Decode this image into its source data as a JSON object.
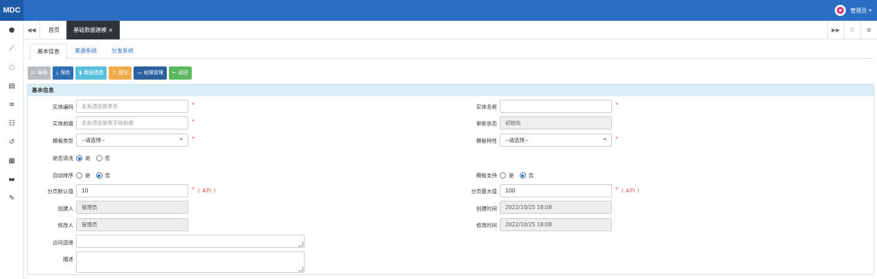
{
  "app": {
    "brand": "MDC"
  },
  "user": {
    "name": "管理员",
    "caret": "▾"
  },
  "sidebar": {
    "icons": [
      "dot-icon",
      "chart-line-icon",
      "spinner-icon",
      "database-icon",
      "list-icon",
      "grid-list-icon",
      "history-icon",
      "film-icon",
      "inbox-icon",
      "wrench-icon"
    ]
  },
  "tabs": {
    "back_glyph": "◀◀",
    "forward_glyph": "▶▶",
    "items": [
      {
        "label": "首页"
      },
      {
        "label": "基础数据建模",
        "close": "×"
      }
    ]
  },
  "subtabs": [
    "基本信息",
    "来源系统",
    "分发系统"
  ],
  "toolbar": {
    "edit": "编辑",
    "save": "保存",
    "model": "数据建模",
    "submit": "提交",
    "permission": "权限管理",
    "back": "返回"
  },
  "panel": {
    "title": "基本信息"
  },
  "form": {
    "entity_code": {
      "label": "实体编码",
      "placeholder": "此处添加是表名",
      "value": ""
    },
    "entity_prefix": {
      "label": "实体前缀",
      "placeholder": "此处添加是表字段前缀",
      "value": ""
    },
    "template_type": {
      "label": "模板类型",
      "value": "--请选择--"
    },
    "is_clean": {
      "label": "是否清洗",
      "options": [
        "是",
        "否"
      ],
      "selected": "是"
    },
    "auto_sort": {
      "label": "自动排序",
      "options": [
        "是",
        "否"
      ],
      "selected": "否"
    },
    "page_default": {
      "label": "分页默认值",
      "value": "10",
      "note": "( API )"
    },
    "creator": {
      "label": "创建人",
      "value": "管理员"
    },
    "modifier": {
      "label": "修改人",
      "value": "管理员"
    },
    "access_link": {
      "label": "访问连接",
      "value": ""
    },
    "description": {
      "label": "描述",
      "value": ""
    },
    "entity_name": {
      "label": "实体名称",
      "value": ""
    },
    "approval_status": {
      "label": "审批状态",
      "value": "初始化"
    },
    "template_feature": {
      "label": "模板特性",
      "value": "--请选择--"
    },
    "template_support": {
      "label": "模板支持",
      "options": [
        "是",
        "否"
      ],
      "selected": "否"
    },
    "page_max": {
      "label": "分页最大值",
      "value": "100",
      "note": "( API )"
    },
    "create_time": {
      "label": "创建时间",
      "value": "2022/10/25 18:08"
    },
    "modify_time": {
      "label": "修改时间",
      "value": "2022/10/25 18:08"
    },
    "required_mark": "*"
  },
  "colors": {
    "topbar": "#2b6fc4",
    "active_tab": "#2f3439",
    "panel_head": "#d9edf7",
    "required": "#d9534f"
  }
}
